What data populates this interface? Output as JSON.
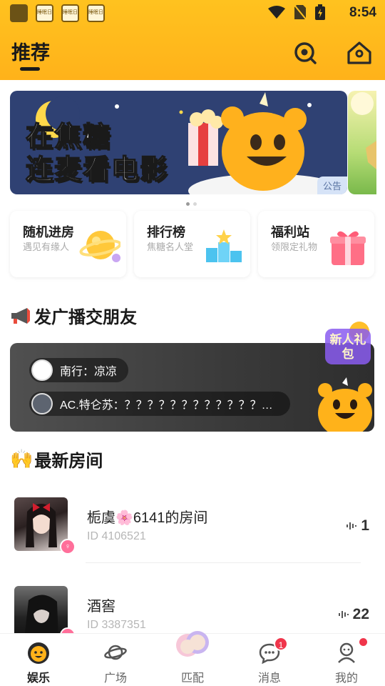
{
  "status_bar": {
    "time": "8:54",
    "app_icon_label": "睡眠日"
  },
  "header": {
    "title": "推荐"
  },
  "banner": {
    "line1": "在焦糖",
    "line2": "连麦看电影",
    "tag": "公告"
  },
  "features": [
    {
      "title": "随机进房",
      "subtitle": "遇见有缘人"
    },
    {
      "title": "排行榜",
      "subtitle": "焦糖名人堂"
    },
    {
      "title": "福利站",
      "subtitle": "领限定礼物"
    }
  ],
  "broadcast": {
    "section_title": "发广播交朋友",
    "messages": [
      {
        "text": "南行：凉凉"
      },
      {
        "text": "AC.特仑苏：？？？？？？？？？？？？…"
      }
    ],
    "gift_label": "新人礼包"
  },
  "rooms_section": {
    "title": "最新房间",
    "rooms": [
      {
        "name": "栀虞🌸6141的房间",
        "id": "ID 4106521",
        "count": "1"
      },
      {
        "name": "酒窖",
        "id": "ID 3387351",
        "count": "22"
      }
    ]
  },
  "nav": {
    "items": [
      {
        "label": "娱乐"
      },
      {
        "label": "广场"
      },
      {
        "label": "匹配"
      },
      {
        "label": "消息",
        "badge": "1"
      },
      {
        "label": "我的"
      }
    ]
  },
  "colors": {
    "brand": "#FFB81C",
    "badge": "#F0354B"
  }
}
